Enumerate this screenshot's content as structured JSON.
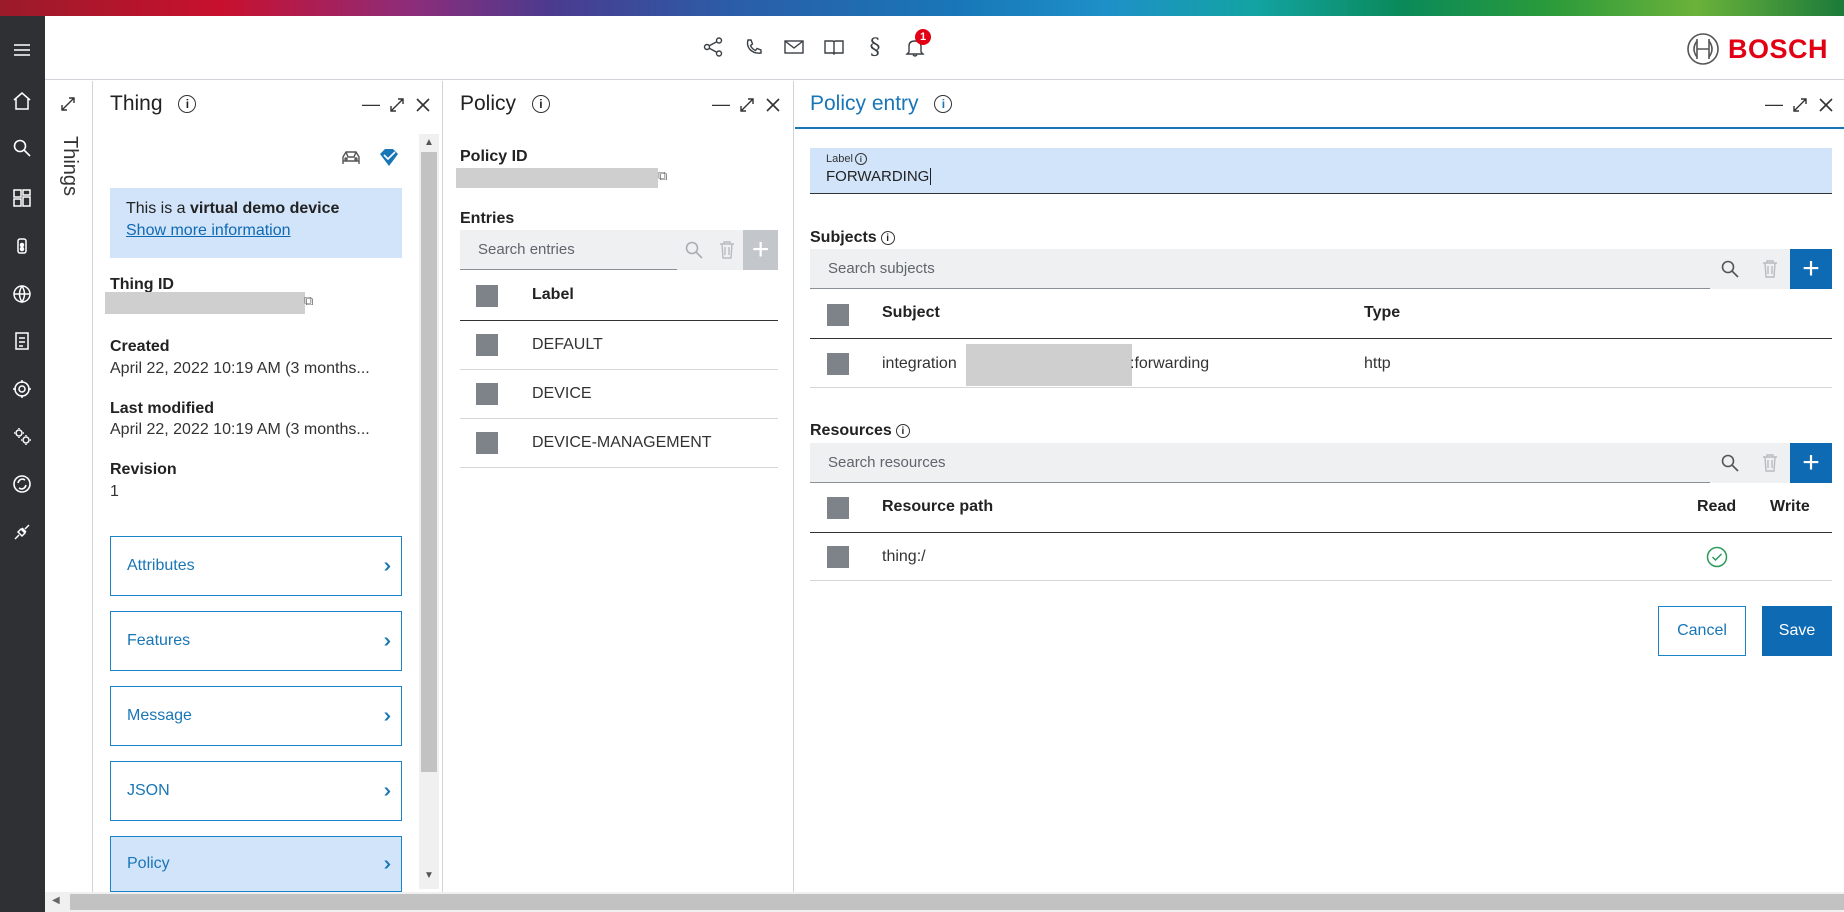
{
  "header": {
    "notification_count": "1",
    "brand": "BOSCH",
    "icons": [
      "share-icon",
      "phone-icon",
      "mail-icon",
      "book-icon",
      "legal-icon",
      "bell-icon"
    ]
  },
  "sidebar": {
    "icons": [
      "menu-icon",
      "home-icon",
      "search-icon",
      "dashboard-icon",
      "device-icon",
      "globe-icon",
      "checklist-icon",
      "rules-icon",
      "settings-icon",
      "sync-icon",
      "plug-icon"
    ]
  },
  "collapsed": {
    "label": "Things"
  },
  "thing": {
    "title": "Thing",
    "demo_prefix": "This is a ",
    "demo_bold": "virtual demo device",
    "demo_link": "Show more information",
    "thing_id_label": "Thing ID",
    "created_label": "Created",
    "created_value": "April 22, 2022 10:19 AM (3 months...",
    "modified_label": "Last modified",
    "modified_value": "April 22, 2022 10:19 AM (3 months...",
    "revision_label": "Revision",
    "revision_value": "1",
    "nav": [
      "Attributes",
      "Features",
      "Message",
      "JSON",
      "Policy"
    ]
  },
  "policy": {
    "title": "Policy",
    "policy_id_label": "Policy ID",
    "entries_label": "Entries",
    "search_placeholder": "Search entries",
    "col_label": "Label",
    "rows": [
      "DEFAULT",
      "DEVICE",
      "DEVICE-MANAGEMENT"
    ]
  },
  "entry": {
    "title": "Policy entry",
    "label_caption": "Label",
    "label_value": "FORWARDING",
    "subjects_label": "Subjects",
    "subjects_search": "Search subjects",
    "col_subject": "Subject",
    "col_type": "Type",
    "subject_prefix": "integration",
    "subject_suffix": ":forwarding",
    "subject_type": "http",
    "resources_label": "Resources",
    "resources_search": "Search resources",
    "col_resource": "Resource path",
    "col_read": "Read",
    "col_write": "Write",
    "resource_path": "thing:/",
    "cancel": "Cancel",
    "save": "Save"
  },
  "colors": {
    "accent": "#0f6ab4",
    "highlight": "#d1e4fa",
    "sidebar": "#2e3033",
    "brand_red": "#e20015"
  }
}
